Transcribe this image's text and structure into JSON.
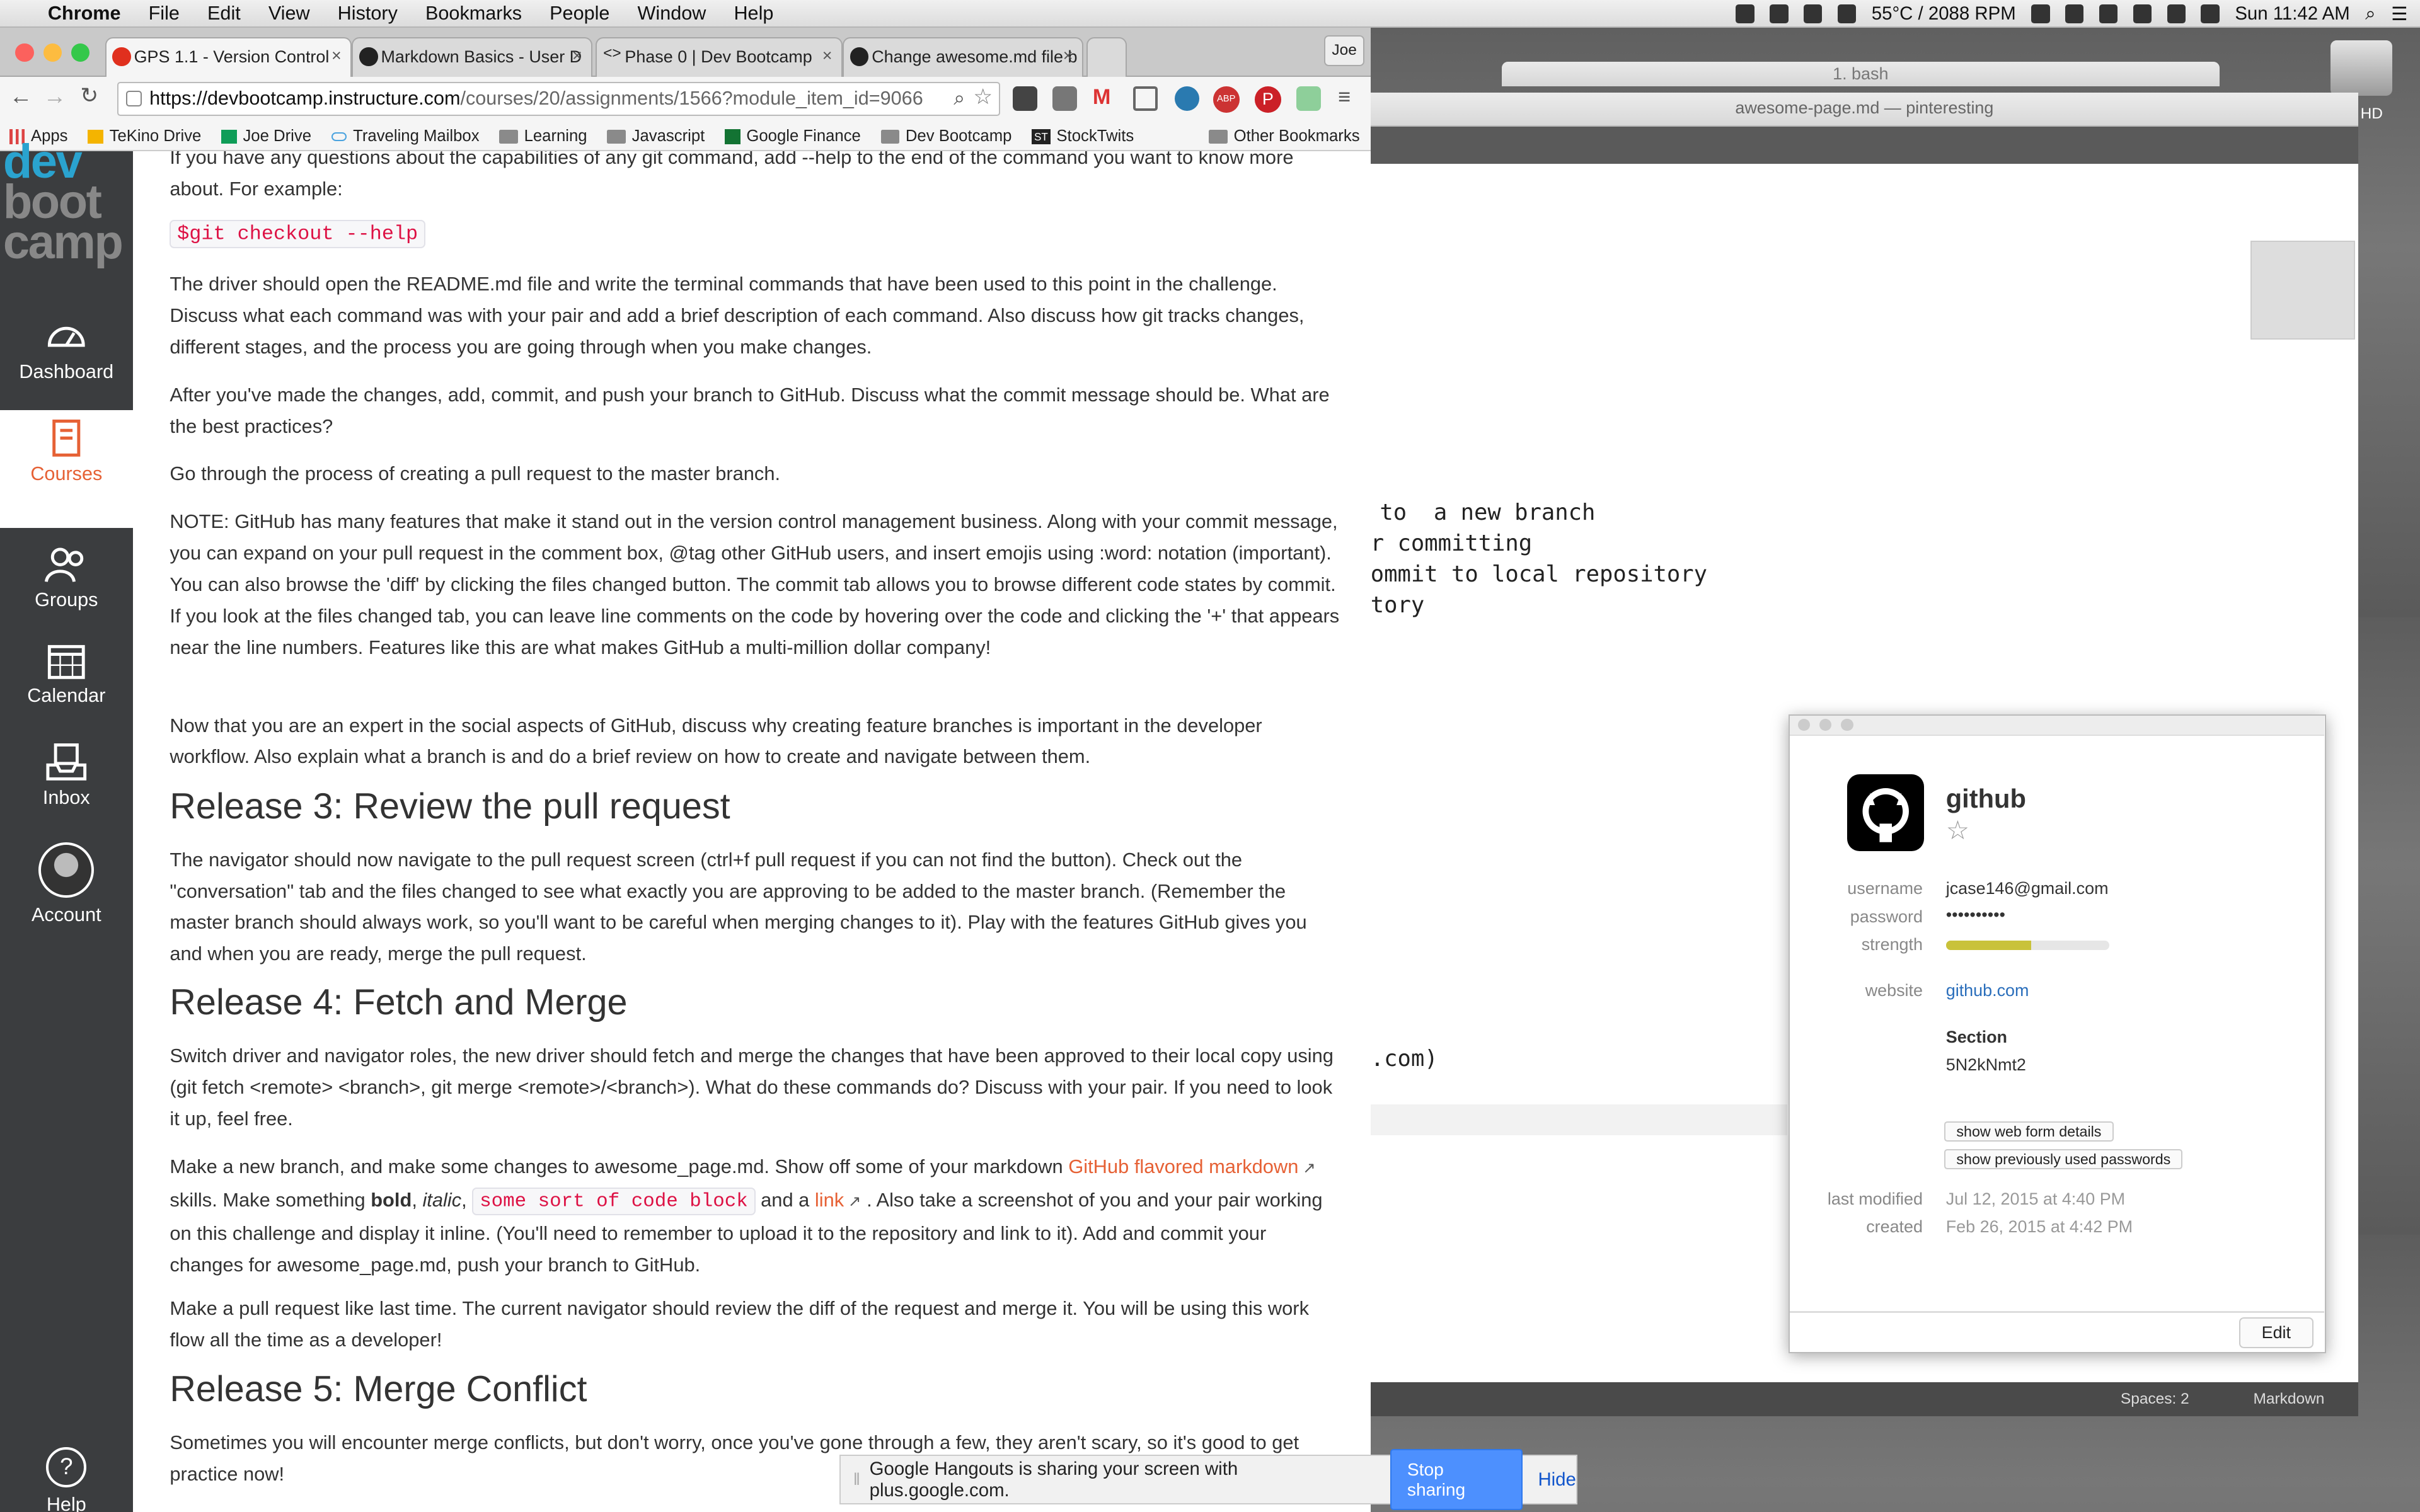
{
  "menubar": {
    "app": "Chrome",
    "items": [
      "File",
      "Edit",
      "View",
      "History",
      "Bookmarks",
      "People",
      "Window",
      "Help"
    ],
    "temp": "55°C / 2088 RPM",
    "clock": "Sun 11:42 AM"
  },
  "browser": {
    "tabs": [
      {
        "label": "GPS 1.1 - Version Control"
      },
      {
        "label": "Markdown Basics - User D"
      },
      {
        "label": "Phase 0 | Dev Bootcamp"
      },
      {
        "label": "Change awesome.md file b"
      }
    ],
    "profile": "Joe",
    "url_host": "https://devbootcamp.instructure.com",
    "url_path": "/courses/20/assignments/1566?module_item_id=9066",
    "bookmarks": [
      "Apps",
      "TeKino Drive",
      "Joe Drive",
      "Traveling Mailbox",
      "Learning",
      "Javascript",
      "Google Finance",
      "Dev Bootcamp",
      "StockTwits"
    ],
    "other_bookmarks": "Other Bookmarks"
  },
  "sidebar": {
    "logo": [
      "dev",
      "boot",
      "camp"
    ],
    "items": [
      "Dashboard",
      "Courses",
      "Groups",
      "Calendar",
      "Inbox",
      "Account",
      "Help"
    ]
  },
  "content": {
    "p1": "If you have any questions about the capabilities of any git command, add --help to the end of the command you want to know more about. For example:",
    "code1": "$git checkout --help",
    "p2": "The driver should open the README.md file and write the terminal commands that have been used to this point in the challenge. Discuss what each command was with your pair and add a brief description of each command. Also discuss how git tracks changes, different stages, and the process you are going through when you make changes.",
    "p3": "After you've made the changes, add, commit, and push your branch to GitHub. Discuss what the commit message should be. What are the best practices?",
    "p4": "Go through the process of creating a pull request to the master branch.",
    "p5": "NOTE: GitHub has many features that make it stand out in the version control management business. Along with your commit message, you can expand on your pull request in the comment box, @tag other GitHub users, and insert emojis using :word: notation (important). You can also browse the 'diff' by clicking the files changed button. The commit tab allows you to browse different code states by commit. If you look at the files changed tab, you can leave line comments on the code by hovering over the code and clicking the '+' that appears near the line numbers. Features like this are what makes GitHub a multi-million dollar company!",
    "p6": "Now that you are an expert in the social aspects of GitHub, discuss why creating feature branches is important in the developer workflow. Also explain what a branch is and do a brief review on how to create and navigate between them.",
    "h3": "Release 3: Review the pull request",
    "p7": "The navigator should now navigate to the pull request screen (ctrl+f pull request if you can not find the button). Check out the \"conversation\" tab and the files changed to see what exactly you are approving to be added to the master branch. (Remember the master branch should always work, so you'll want to be careful when merging changes to it). Play with the features GitHub gives you and when you are ready, merge the pull request.",
    "h4": "Release 4: Fetch and Merge",
    "p8": "Switch driver and navigator roles, the new driver should fetch and merge the changes that have been approved to their local copy using (git fetch <remote> <branch>, git merge <remote>/<branch>). What do these commands do? Discuss with your pair. If you need to look it up, feel free.",
    "p9a": "Make a new branch, and make some changes to awesome_page.md. Show off some of your markdown ",
    "p9link": "GitHub flavored markdown",
    "p9b": " skills. Make something ",
    "p9bold": "bold",
    "p9c": ", ",
    "p9italic": "italic",
    "p9d": ", ",
    "p9code": "some sort of code block",
    "p9e": " and a ",
    "p9link2": "link",
    "p9f": " . Also take a screenshot of you and your pair working on this challenge and display it inline. (You'll need to remember to upload it to the repository and link to it). Add and commit your changes for awesome_page.md, push your branch to GitHub.",
    "p10": "Make a pull request like last time. The current navigator should review the diff of the request and merge it. You will be using this work flow all the time as a developer!",
    "h5": "Release 5: Merge Conflict",
    "p11": "Sometimes you will encounter merge conflicts, but don't worry, once you've gone through a few, they aren't scary, so it's good to get practice now!"
  },
  "terminal": {
    "title": "1. bash"
  },
  "editor": {
    "title": "awesome-page.md — pinteresting",
    "lines": [
      "to  a new branch",
      "r committing",
      "ommit to local repository",
      "tory",
      ".com)"
    ],
    "spaces": "Spaces: 2",
    "syntax": "Markdown"
  },
  "onepassword": {
    "title": "github",
    "username_label": "username",
    "username": "jcase146@gmail.com",
    "password_label": "password",
    "password": "••••••••••",
    "strength_label": "strength",
    "strength_fraction": 0.52,
    "website_label": "website",
    "website": "github.com",
    "section_title": "Section",
    "section_value": "5N2kNmt2",
    "btn_form": "show web form details",
    "btn_prev": "show previously used passwords",
    "modified_label": "last modified",
    "modified": "Jul 12, 2015 at 4:40 PM",
    "created_label": "created",
    "created": "Feb 26, 2015 at 4:42 PM",
    "edit": "Edit"
  },
  "hangouts": {
    "message": "Google Hangouts is sharing your screen with plus.google.com.",
    "stop": "Stop sharing",
    "hide": "Hide"
  },
  "desktop": {
    "drive": "sh HD"
  }
}
